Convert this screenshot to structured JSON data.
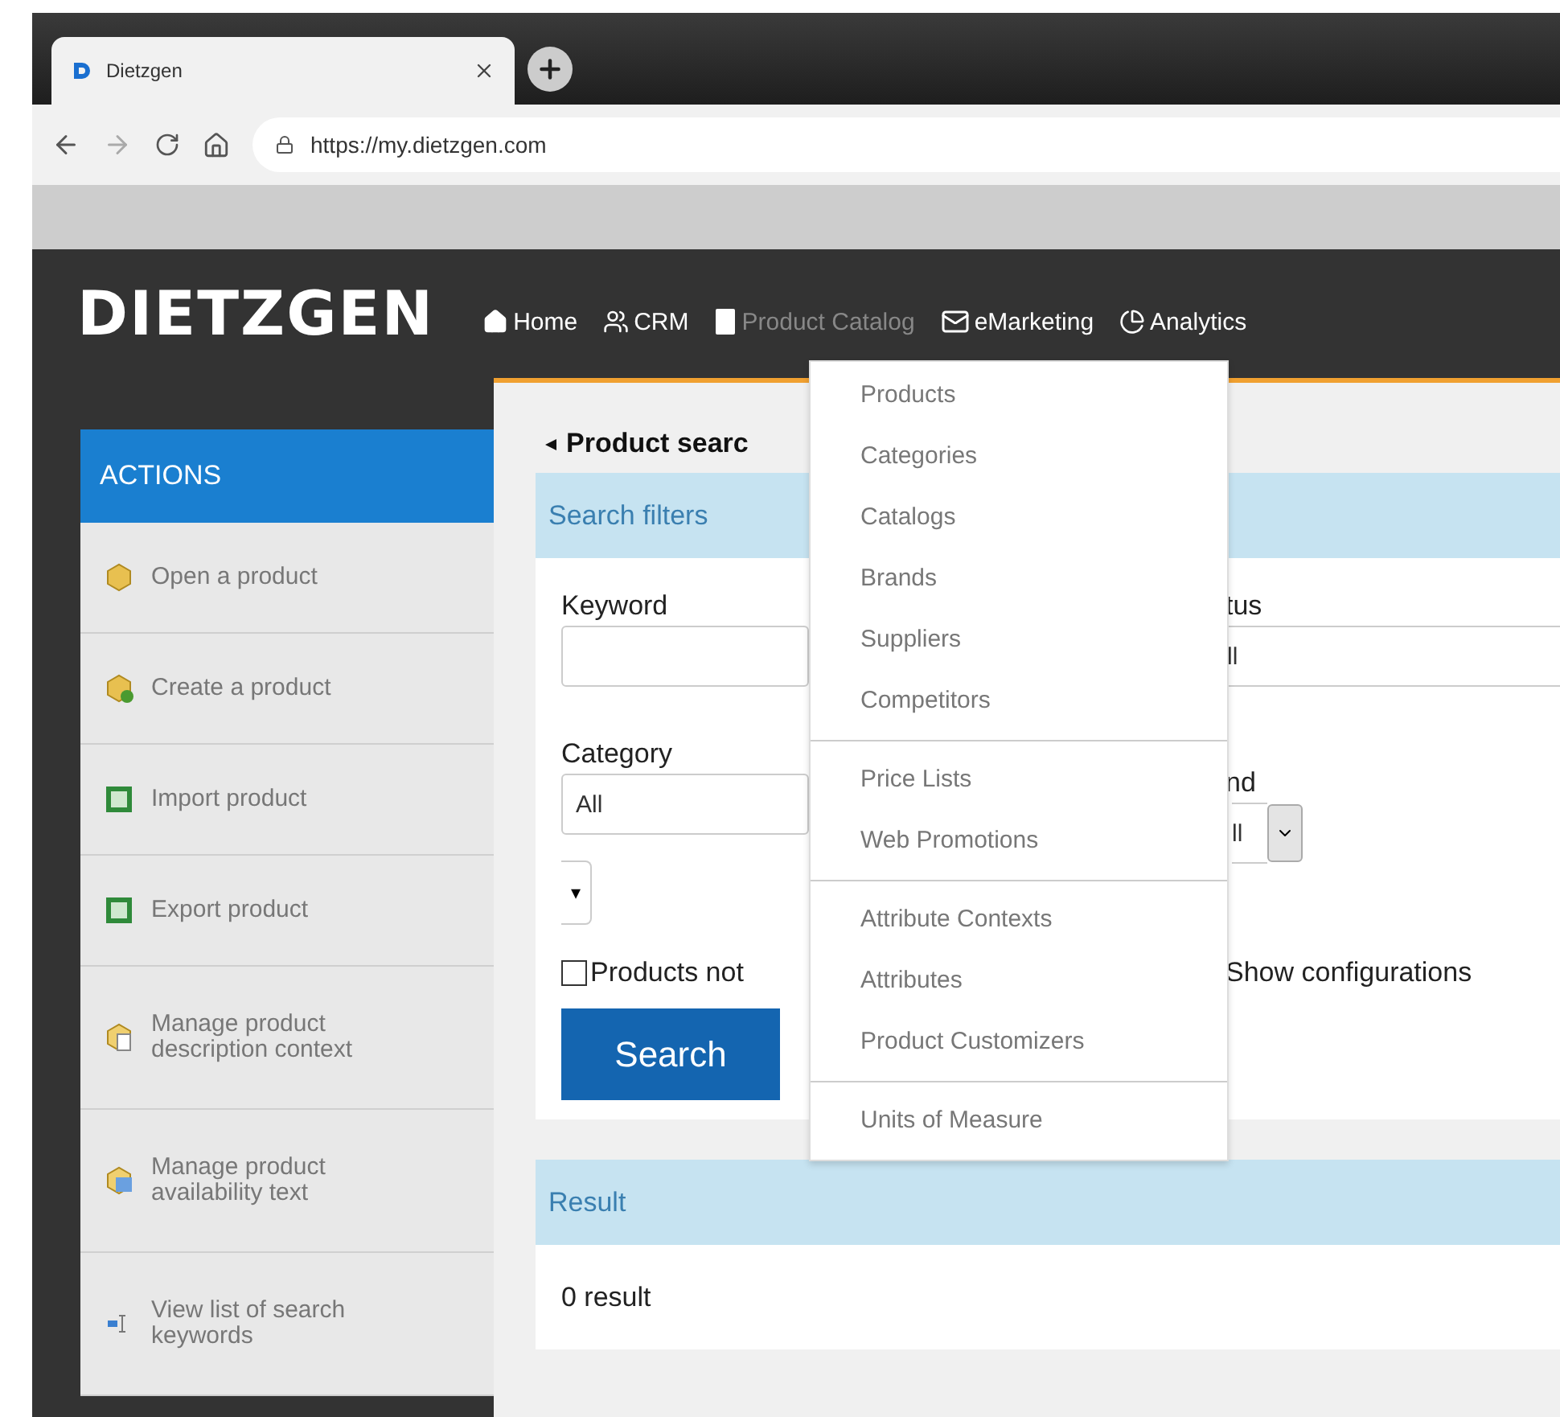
{
  "browser": {
    "tab_title": "Dietzgen",
    "url": "https://my.dietzgen.com"
  },
  "header": {
    "logo": "DIETZGEN",
    "nav": [
      {
        "label": "Home",
        "kind": "home",
        "selected": false
      },
      {
        "label": "CRM",
        "kind": "users",
        "selected": false
      },
      {
        "label": "Product Catalog",
        "kind": "book",
        "selected": true
      },
      {
        "label": "eMarketing",
        "kind": "mail",
        "selected": false
      },
      {
        "label": "Analytics",
        "kind": "chart",
        "selected": false
      }
    ]
  },
  "menu": {
    "groups": [
      [
        "Products",
        "Categories",
        "Catalogs",
        "Brands",
        "Suppliers",
        "Competitors"
      ],
      [
        "Price Lists",
        "Web Promotions"
      ],
      [
        "Attribute Contexts",
        "Attributes",
        "Product Customizers"
      ],
      [
        "Units of Measure"
      ]
    ]
  },
  "sidebar": {
    "title": "ACTIONS",
    "items": [
      {
        "label": "Open a product",
        "kind": "box"
      },
      {
        "label": "Create a product",
        "kind": "box-add"
      },
      {
        "label": "Import product",
        "kind": "sheet"
      },
      {
        "label": "Export product",
        "kind": "sheet"
      },
      {
        "label": "Manage product description context",
        "kind": "box-doc"
      },
      {
        "label": "Manage product availability text",
        "kind": "box-image"
      },
      {
        "label": "View list of search keywords",
        "kind": "keyword"
      }
    ]
  },
  "main": {
    "breadcrumb": "Product searc",
    "filters": {
      "title": "Search filters",
      "keyword_label": "Keyword",
      "category_label": "Category",
      "category_value": "All",
      "small_select": "▾",
      "status_label": "tus",
      "status_value": "ll",
      "brand_label": "nd",
      "brand_value": "ll",
      "products_not": {
        "label": "Products not",
        "checked": false
      },
      "show_configurations": "Show configurations",
      "search_button": "Search"
    },
    "result": {
      "title": "Result",
      "text": "0 result"
    }
  }
}
